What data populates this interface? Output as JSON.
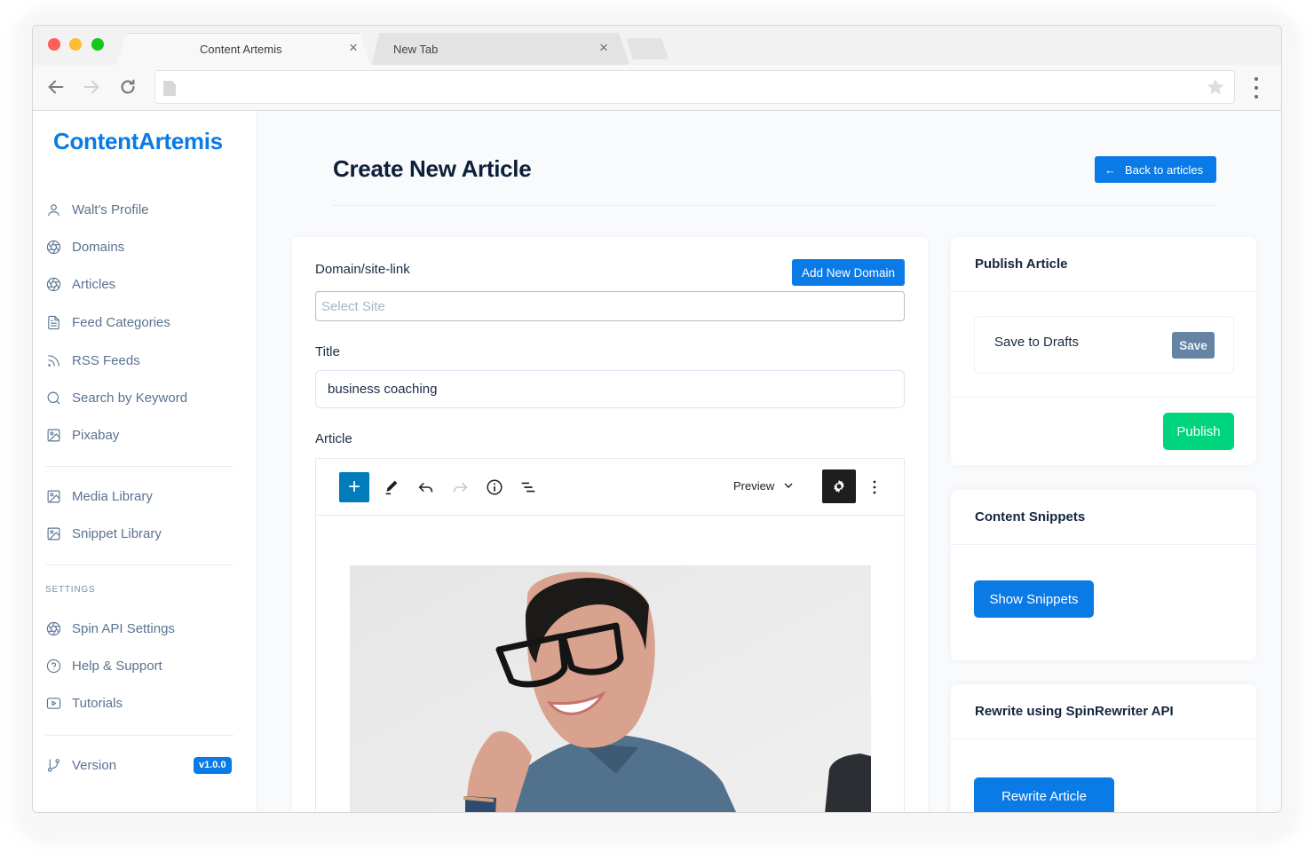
{
  "browser": {
    "tabs": [
      {
        "label": "Content Artemis",
        "active": true
      },
      {
        "label": "New Tab",
        "active": false
      }
    ],
    "address": {
      "value": "",
      "placeholder": ""
    },
    "icons": {
      "back": "arrow-left-icon",
      "forward": "arrow-right-icon",
      "reload": "reload-icon",
      "page": "document-icon",
      "bookmark": "star-icon",
      "menu": "vertical-dots-icon",
      "tab_close": "close-icon"
    },
    "tab_close_glyph": "×"
  },
  "sidebar": {
    "brand": "ContentArtemis",
    "items": [
      {
        "label": "Walt's Profile",
        "icon": "user-icon"
      },
      {
        "label": "Domains",
        "icon": "aperture-icon"
      },
      {
        "label": "Articles",
        "icon": "aperture-icon"
      },
      {
        "label": "Feed Categories",
        "icon": "file-text-icon"
      },
      {
        "label": "RSS Feeds",
        "icon": "rss-icon"
      },
      {
        "label": "Search by Keyword",
        "icon": "search-icon"
      },
      {
        "label": "Pixabay",
        "icon": "image-icon"
      }
    ],
    "library_items": [
      {
        "label": "Media Library",
        "icon": "image-icon"
      },
      {
        "label": "Snippet Library",
        "icon": "image-icon"
      }
    ],
    "settings_label": "SETTINGS",
    "settings_items": [
      {
        "label": "Spin API Settings",
        "icon": "aperture-icon"
      },
      {
        "label": "Help & Support",
        "icon": "help-circle-icon"
      },
      {
        "label": "Tutorials",
        "icon": "video-play-icon"
      }
    ],
    "version": {
      "label": "Version",
      "icon": "git-branch-icon",
      "badge": "v1.0.0"
    }
  },
  "main": {
    "page_title": "Create New Article",
    "back_button": {
      "label": "Back to articles",
      "icon": "arrow-left-icon",
      "glyph": "←"
    },
    "form": {
      "domain_label": "Domain/site-link",
      "add_domain_label": "Add New Domain",
      "select_site": {
        "value": "",
        "placeholder": "Select Site"
      },
      "title_label": "Title",
      "title_input": {
        "value": "business coaching",
        "placeholder": ""
      },
      "article_label": "Article"
    },
    "editor_toolbar": {
      "add_block_glyph": "+",
      "tools": [
        "pencil-icon",
        "undo-icon",
        "redo-icon",
        "info-icon",
        "list-view-icon"
      ],
      "preview_label": "Preview",
      "settings_icon": "gear-icon",
      "more_icon": "vertical-dots-icon"
    },
    "editor_image": {
      "alt": "Smiling person with short dark hair and black glasses, resting head on hand"
    }
  },
  "panels": {
    "publish": {
      "title": "Publish Article",
      "drafts_label": "Save to Drafts",
      "save_label": "Save",
      "publish_label": "Publish"
    },
    "snippets": {
      "title": "Content Snippets",
      "button_label": "Show Snippets"
    },
    "rewrite": {
      "title": "Rewrite using SpinRewriter API",
      "button_label": "Rewrite Article"
    }
  },
  "colors": {
    "brand": "#0a7ae6",
    "publish": "#00d57d",
    "save": "#6584a3",
    "editor_add": "#007cba",
    "editor_settings": "#1e1e1e",
    "sidebar_text": "#5a7391",
    "heading": "#0f1f3a"
  }
}
